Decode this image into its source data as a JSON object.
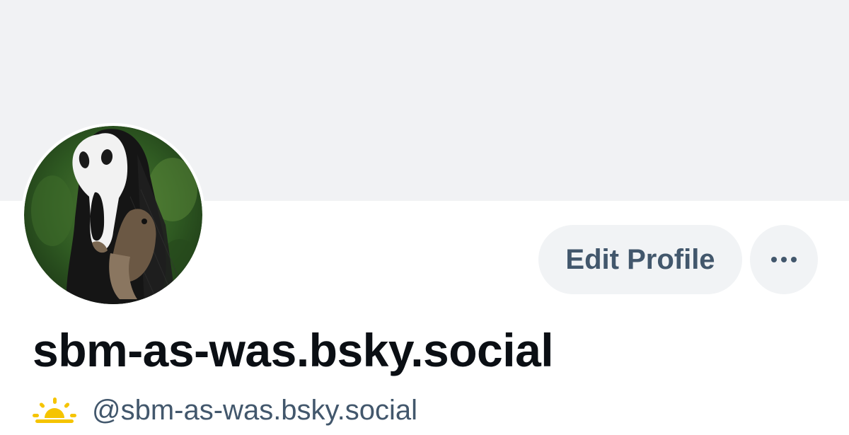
{
  "profile": {
    "display_name": "sbm-as-was.bsky.social",
    "handle": "@sbm-as-was.bsky.social",
    "handle_prefix_icon": "sun-icon",
    "avatar_icon": "ghostface-mask-avatar"
  },
  "actions": {
    "edit_profile_label": "Edit Profile",
    "more_icon": "ellipsis-icon"
  },
  "colors": {
    "banner": "#f1f2f4",
    "button_bg": "#f1f3f5",
    "button_text": "#42576c",
    "name_text": "#0b0f14",
    "handle_text": "#42576c",
    "sun": "#f5c400"
  }
}
